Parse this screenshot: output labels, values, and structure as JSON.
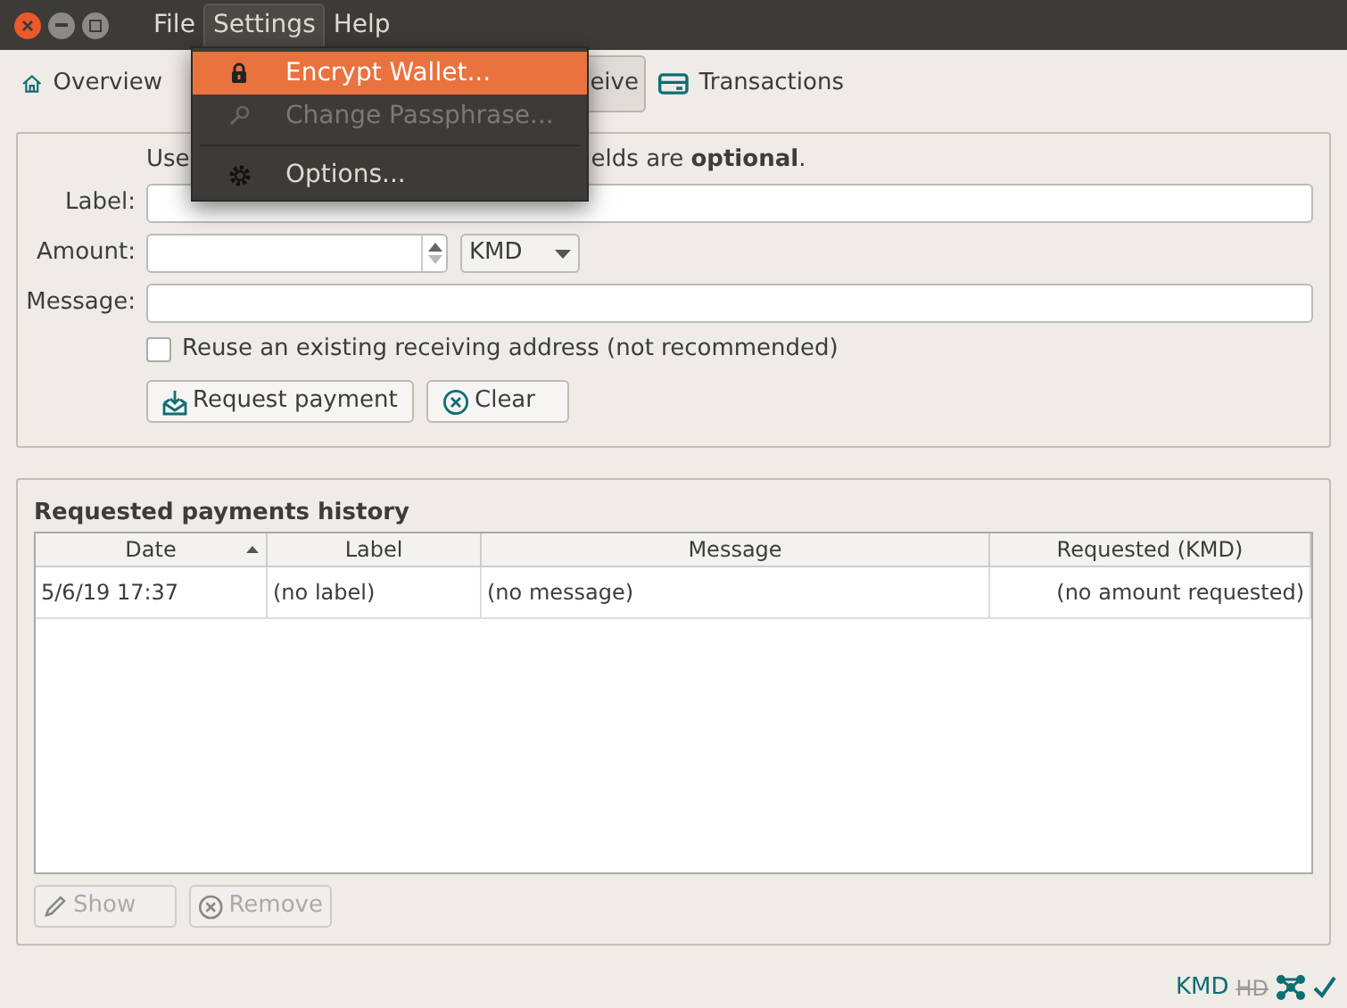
{
  "window": {
    "menu": [
      {
        "label": "File",
        "selected": false
      },
      {
        "label": "Settings",
        "selected": true
      },
      {
        "label": "Help",
        "selected": false
      }
    ]
  },
  "toolbar": {
    "tabs": [
      {
        "label": "Overview",
        "selected": false
      },
      {
        "label": "eive",
        "selected": true
      },
      {
        "label": "Transactions",
        "selected": false
      }
    ]
  },
  "settings_menu": [
    {
      "kind": "item",
      "label": "Encrypt Wallet...",
      "selected": true,
      "disabled": false
    },
    {
      "kind": "item",
      "label": "Change Passphrase...",
      "selected": false,
      "disabled": true
    },
    {
      "kind": "separator"
    },
    {
      "kind": "item",
      "label": "Options...",
      "selected": false,
      "disabled": false
    }
  ],
  "form": {
    "intro_left": "Use",
    "intro_right": "elds are **optional**.",
    "label": {
      "caption": "Label:"
    },
    "amount": {
      "caption": "Amount:",
      "unit": "KMD"
    },
    "message": {
      "caption": "Message:"
    },
    "reuse": {
      "label": "Reuse an existing receiving address (not recommended)",
      "checked": false
    },
    "buttons": [
      {
        "label": "Request payment"
      },
      {
        "label": "Clear"
      }
    ]
  },
  "history": {
    "title": "Requested payments history",
    "columns": [
      {
        "label": "Date",
        "sorted": true
      },
      {
        "label": "Label",
        "sorted": false
      },
      {
        "label": "Message",
        "sorted": false
      },
      {
        "label": "Requested (KMD)",
        "sorted": false
      }
    ],
    "rows": [
      [
        "5/6/19 17:37",
        "(no label)",
        "(no message)",
        "(no amount requested)"
      ]
    ],
    "buttons": [
      {
        "label": "Show",
        "disabled": true
      },
      {
        "label": "Remove",
        "disabled": true
      }
    ]
  },
  "status_bar": {
    "unit": "KMD",
    "hd": {
      "label": "HD",
      "disabled": true
    }
  }
}
